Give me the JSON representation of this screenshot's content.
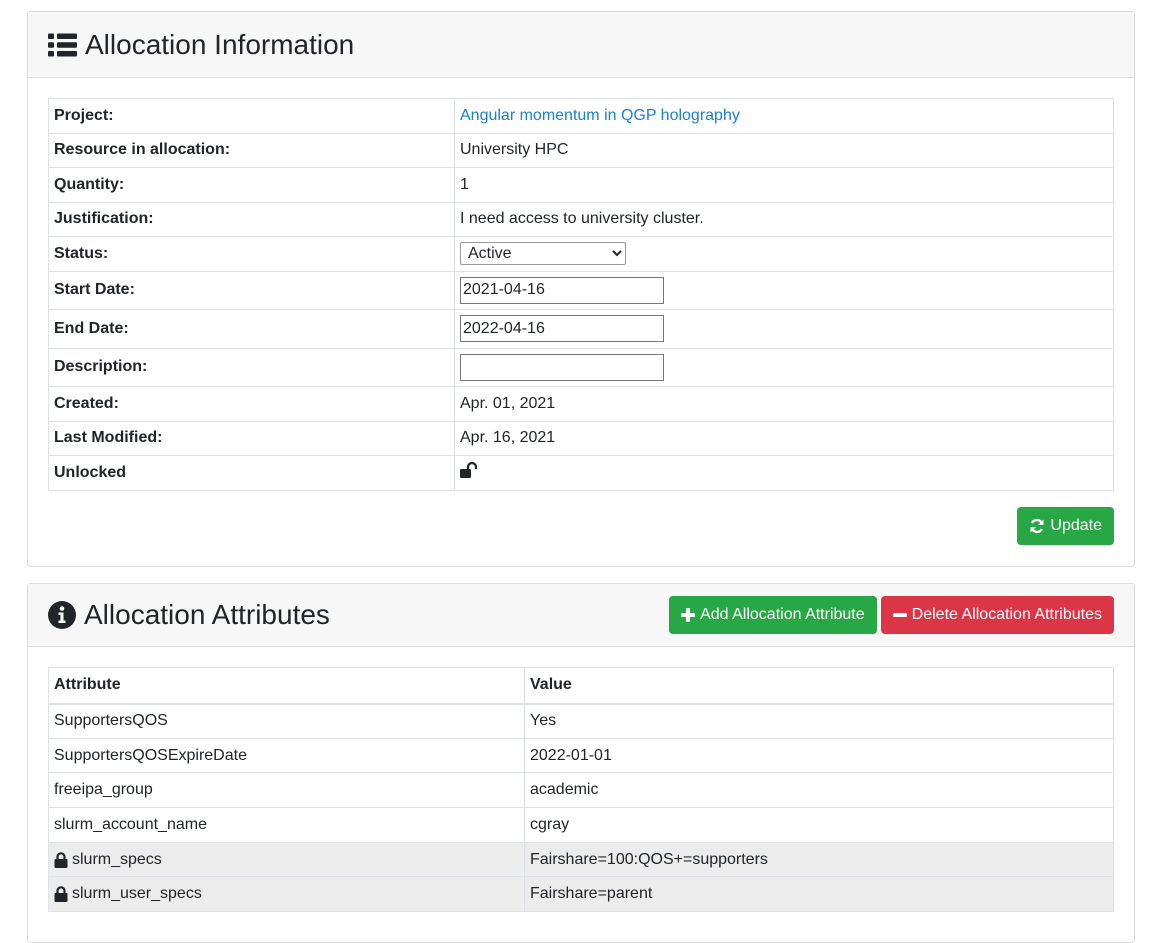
{
  "allocation_info": {
    "title": "Allocation Information",
    "rows": {
      "project": {
        "label": "Project:",
        "value": "Angular momentum in QGP holography"
      },
      "resource": {
        "label": "Resource in allocation:",
        "value": "University HPC"
      },
      "quantity": {
        "label": "Quantity:",
        "value": "1"
      },
      "justification": {
        "label": "Justification:",
        "value": "I need access to university cluster."
      },
      "status": {
        "label": "Status:",
        "value": "Active"
      },
      "start_date": {
        "label": "Start Date:",
        "value": "2021-04-16"
      },
      "end_date": {
        "label": "End Date:",
        "value": "2022-04-16"
      },
      "description": {
        "label": "Description:",
        "value": ""
      },
      "created": {
        "label": "Created:",
        "value": "Apr. 01, 2021"
      },
      "last_modified": {
        "label": "Last Modified:",
        "value": "Apr. 16, 2021"
      },
      "unlocked": {
        "label": "Unlocked",
        "icon": "unlock-icon"
      }
    },
    "update_label": "Update"
  },
  "allocation_attributes": {
    "title": "Allocation Attributes",
    "add_label": "Add Allocation Attribute",
    "delete_label": "Delete Allocation Attributes",
    "headers": {
      "attribute": "Attribute",
      "value": "Value"
    },
    "rows": [
      {
        "attribute": "SupportersQOS",
        "value": "Yes"
      },
      {
        "attribute": "SupportersQOSExpireDate",
        "value": "2022-01-01"
      },
      {
        "attribute": "freeipa_group",
        "value": "academic"
      },
      {
        "attribute": "slurm_account_name",
        "value": "cgray"
      },
      {
        "attribute": "slurm_specs",
        "value": "Fairshare=100:QOS+=supporters",
        "locked": true
      },
      {
        "attribute": "slurm_user_specs",
        "value": "Fairshare=parent",
        "locked": true
      }
    ]
  },
  "colors": {
    "link": "#1a7fd6",
    "success": "#28a745",
    "danger": "#dc3545",
    "header_bg": "#f7f7f7"
  }
}
